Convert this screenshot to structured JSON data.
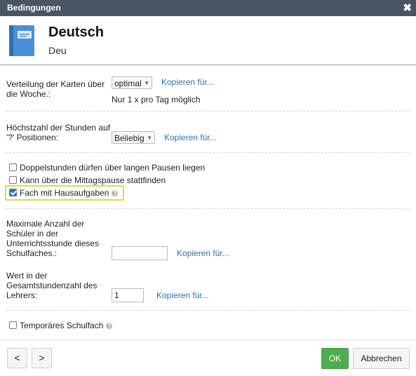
{
  "dialog": {
    "title": "Bedingungen",
    "close_glyph": "✖"
  },
  "subject": {
    "name": "Deutsch",
    "short": "Deu",
    "icon": "book-icon"
  },
  "distribution": {
    "label_line1": "Verteilung der Karten über",
    "label_line2": "die Woche.:",
    "value": "optimal",
    "copy_link": "Kopieren für...",
    "note": "Nur 1 x pro Tag möglich"
  },
  "max_hours": {
    "label_line1": "Höchstzahl der Stunden auf",
    "label_line2": "'?' Positionen:",
    "value": "Beliebig",
    "copy_link": "Kopieren für..."
  },
  "checkboxes": [
    {
      "label": "Doppelstunden dürfen über langen Pausen liegen",
      "checked": false
    },
    {
      "label": "Kann über die Mittagspause stattfinden",
      "checked": false
    },
    {
      "label": "Fach mit Hausaufgaben",
      "checked": true
    }
  ],
  "max_students": {
    "label_line1": "Maximale Anzahl der",
    "label_line2": "Schüler in der",
    "label_line3": "Unterrichtsstunde dieses",
    "label_line4": "Schulfaches.:",
    "value": "",
    "copy_link": "Kopieren für..."
  },
  "weight": {
    "label_line1": "Wert in der",
    "label_line2": "Gesamtstundenzahl des",
    "label_line3": "Lehrers:",
    "value": "1",
    "copy_link": "Kopieren für..."
  },
  "temporary": {
    "label": "Temporäres Schulfach",
    "checked": false
  },
  "footer": {
    "prev": "<",
    "next": ">",
    "ok": "OK",
    "cancel": "Abbrechen"
  },
  "colors": {
    "titlebar": "#4a5563",
    "link": "#2a72b5",
    "ok": "#4cae4c",
    "highlight": "#e6d54a",
    "book": "#4a8fd9"
  }
}
